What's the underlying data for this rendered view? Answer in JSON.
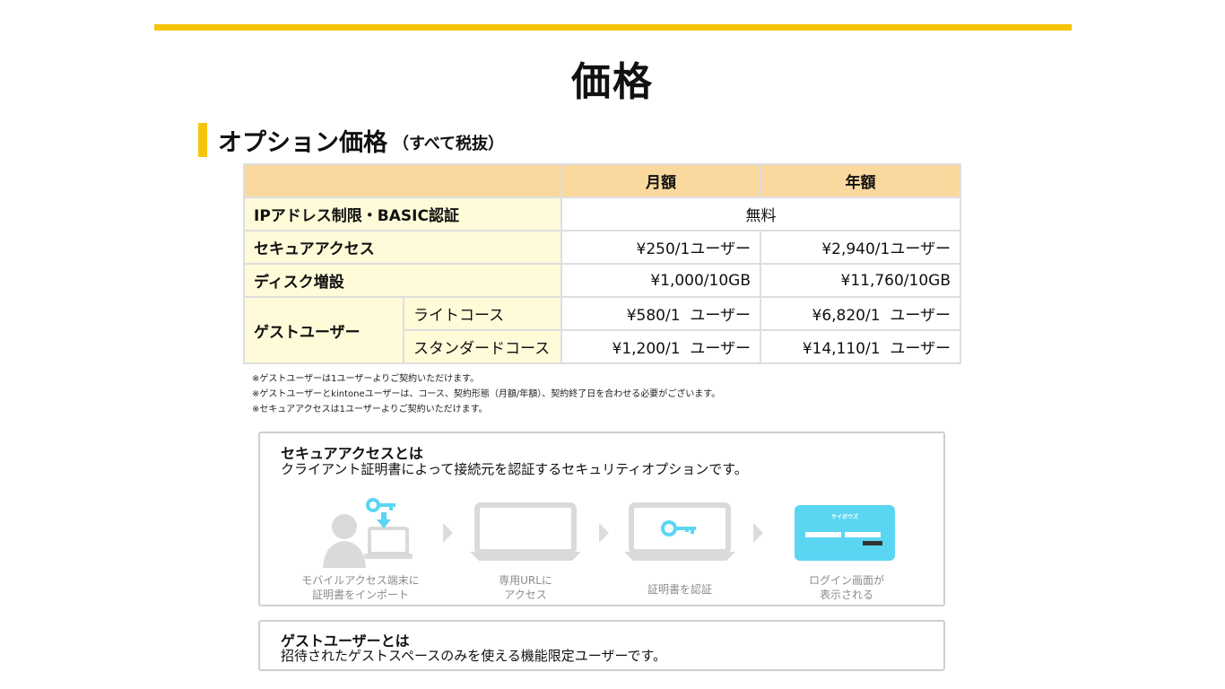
{
  "page": {
    "title": "価格",
    "section_title": "オプション価格",
    "section_subtitle": "（すべて税抜）"
  },
  "price_table": {
    "headers": [
      "",
      "月額",
      "年額"
    ],
    "rows": [
      {
        "label": "IPアドレス制限・BASIC認証",
        "merged": "無料"
      },
      {
        "label": "セキュアアクセス",
        "monthly": "¥250/1ユーザー",
        "yearly": "¥2,940/1ユーザー"
      },
      {
        "label": "ディスク増設",
        "monthly": "¥1,000/10GB",
        "yearly": "¥11,760/10GB"
      },
      {
        "label": "ゲストユーザー",
        "course": "ライトコース",
        "monthly": "¥580/1  ユーザー",
        "yearly": "¥6,820/1  ユーザー"
      },
      {
        "course": "スタンダードコース",
        "monthly": "¥1,200/1  ユーザー",
        "yearly": "¥14,110/1  ユーザー"
      }
    ]
  },
  "notes": [
    "※ゲストユーザーは1ユーザーよりご契約いただけます。",
    "※ゲストユーザーとkintoneユーザーは、コース、契約形態（月額/年額）、契約終了日を合わせる必要がございます。",
    "※セキュアアクセスは1ユーザーよりご契約いただけます。"
  ],
  "secure_access": {
    "title": "セキュアアクセスとは",
    "description": "クライアント証明書によって接続元を認証するセキュリティオプションです。",
    "steps": [
      {
        "line1": "モバイルアクセス端末に",
        "line2": "証明書をインポート",
        "icon": "user-laptop-key-icon"
      },
      {
        "line1": "専用URLに",
        "line2": "アクセス",
        "icon": "laptop-icon"
      },
      {
        "line1": "証明書を認証",
        "line2": "",
        "icon": "laptop-key-icon"
      },
      {
        "line1": "ログイン画面が",
        "line2": "表示される",
        "icon": "login-screen-icon",
        "screen_title": "サイボウズ"
      }
    ],
    "accent_color": "#5ad6f2"
  },
  "guest_user": {
    "title": "ゲストユーザーとは",
    "description": "招待されたゲストスペースのみを使える機能限定ユーザーです。"
  },
  "colors": {
    "accent": "#f5c40c",
    "header_bg": "#fbd99e",
    "label_bg": "#fffbd9"
  }
}
